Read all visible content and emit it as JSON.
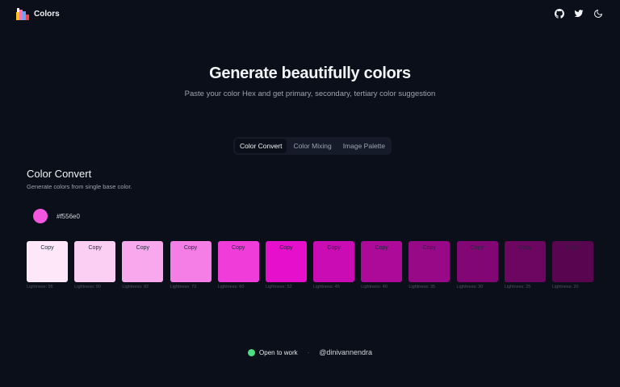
{
  "app": {
    "name": "Colors"
  },
  "header": {
    "icons": [
      "github-icon",
      "twitter-icon",
      "moon-icon"
    ]
  },
  "hero": {
    "title": "Generate beautifully colors",
    "subtitle": "Paste your color Hex and get primary, secondary, tertiary color suggestion"
  },
  "tabs": [
    {
      "label": "Color Convert",
      "active": true
    },
    {
      "label": "Color Mixing",
      "active": false
    },
    {
      "label": "Image Palette",
      "active": false
    }
  ],
  "section": {
    "title": "Color Convert",
    "description": "Generate colors from single base color."
  },
  "base_color": {
    "hex": "#f556e0"
  },
  "swatches": [
    {
      "color": "#fde7f9",
      "copy_label": "Copy",
      "label": "Lightness: 95"
    },
    {
      "color": "#fbcff4",
      "copy_label": "Copy",
      "label": "Lightness: 90"
    },
    {
      "color": "#f8a8ec",
      "copy_label": "Copy",
      "label": "Lightness: 82"
    },
    {
      "color": "#f57ee6",
      "copy_label": "Copy",
      "label": "Lightness: 73"
    },
    {
      "color": "#f03dda",
      "copy_label": "Copy",
      "label": "Lightness: 60"
    },
    {
      "color": "#e60fcc",
      "copy_label": "Copy",
      "label": "Lightness: 52"
    },
    {
      "color": "#c90cb3",
      "copy_label": "Copy",
      "label": "Lightness: 45"
    },
    {
      "color": "#ad0a9a",
      "copy_label": "Copy",
      "label": "Lightness: 40"
    },
    {
      "color": "#970987",
      "copy_label": "Copy",
      "label": "Lightness: 35"
    },
    {
      "color": "#820774",
      "copy_label": "Copy",
      "label": "Lightness: 30"
    },
    {
      "color": "#6d0661",
      "copy_label": "Copy",
      "label": "Lightness: 25"
    },
    {
      "color": "#5a0550",
      "copy_label": "Copy",
      "label": "Lightness: 20"
    }
  ],
  "footer": {
    "status": "Open to work",
    "separator": "·",
    "handle": "@dinivannendra"
  },
  "colors": {
    "background": "#0b0f1a",
    "status_dot": "#4ade80",
    "accent": "#f556e0"
  }
}
